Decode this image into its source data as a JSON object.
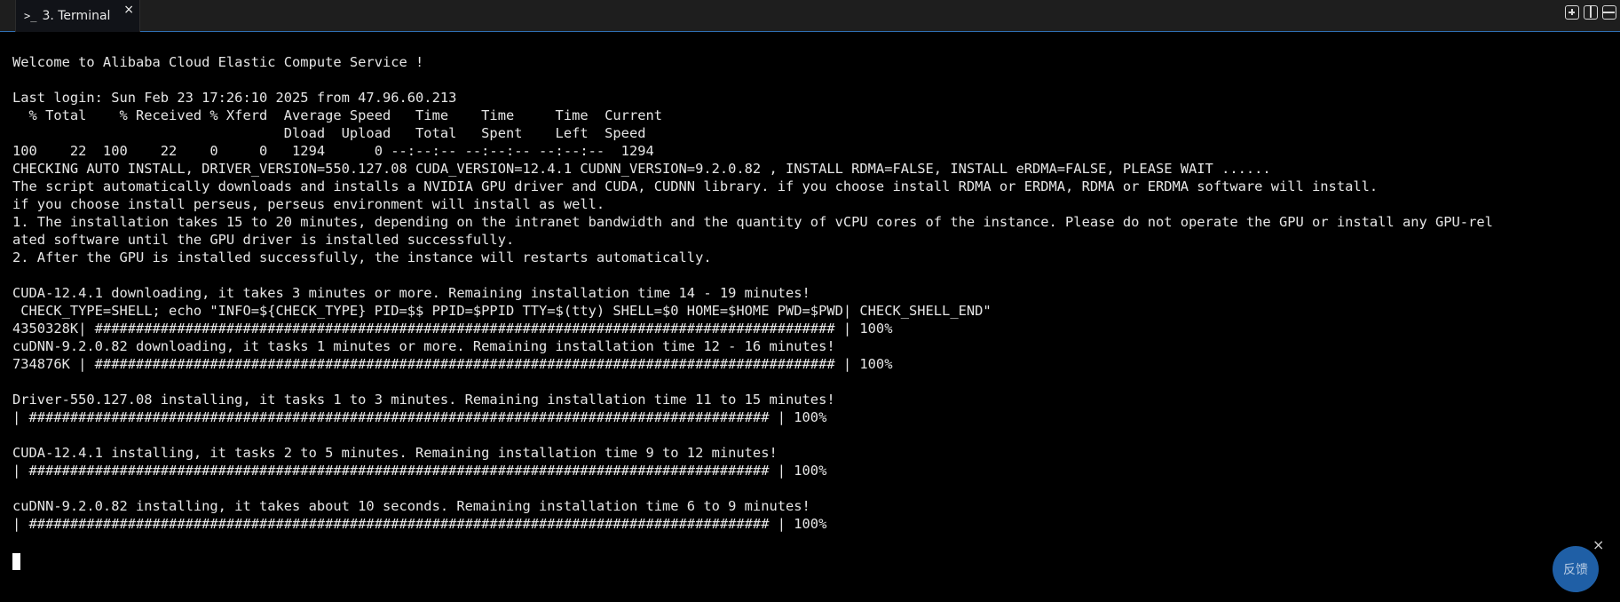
{
  "tab": {
    "icon": ">_",
    "title": "3. Terminal",
    "close_glyph": "×"
  },
  "terminal": {
    "lines": [
      "Welcome to Alibaba Cloud Elastic Compute Service !",
      "",
      "Last login: Sun Feb 23 17:26:10 2025 from 47.96.60.213",
      "  % Total    % Received % Xferd  Average Speed   Time    Time     Time  Current",
      "                                 Dload  Upload   Total   Spent    Left  Speed",
      "100    22  100    22    0     0   1294      0 --:--:-- --:--:-- --:--:--  1294",
      "CHECKING AUTO INSTALL, DRIVER_VERSION=550.127.08 CUDA_VERSION=12.4.1 CUDNN_VERSION=9.2.0.82 , INSTALL RDMA=FALSE, INSTALL eRDMA=FALSE, PLEASE WAIT ......",
      "The script automatically downloads and installs a NVIDIA GPU driver and CUDA, CUDNN library. if you choose install RDMA or ERDMA, RDMA or ERDMA software will install.",
      "if you choose install perseus, perseus environment will install as well.",
      "1. The installation takes 15 to 20 minutes, depending on the intranet bandwidth and the quantity of vCPU cores of the instance. Please do not operate the GPU or install any GPU-rel",
      "ated software until the GPU driver is installed successfully.",
      "2. After the GPU is installed successfully, the instance will restarts automatically.",
      "",
      "CUDA-12.4.1 downloading, it takes 3 minutes or more. Remaining installation time 14 - 19 minutes!",
      " CHECK_TYPE=SHELL; echo \"INFO=${CHECK_TYPE} PID=$$ PPID=$PPID TTY=$(tty) SHELL=$0 HOME=$HOME PWD=$PWD| CHECK_SHELL_END\"",
      "4350328K| ########################################################################################## | 100%",
      "cuDNN-9.2.0.82 downloading, it tasks 1 minutes or more. Remaining installation time 12 - 16 minutes!",
      "734876K | ########################################################################################## | 100%",
      "",
      "Driver-550.127.08 installing, it tasks 1 to 3 minutes. Remaining installation time 11 to 15 minutes!",
      "| ########################################################################################## | 100%",
      "",
      "CUDA-12.4.1 installing, it tasks 2 to 5 minutes. Remaining installation time 9 to 12 minutes!",
      "| ########################################################################################## | 100%",
      "",
      "cuDNN-9.2.0.82 installing, it takes about 10 seconds. Remaining installation time 6 to 9 minutes!",
      "| ########################################################################################## | 100%"
    ]
  },
  "feedback": {
    "label": "反馈",
    "close_glyph": "×"
  },
  "colors": {
    "terminal_bg": "#000000",
    "terminal_fg": "#e6e6e6",
    "tabbar_bg": "#1e1e1e",
    "accent": "#2f6fb3",
    "feedback_bg": "#1f5fa6"
  },
  "icons": {
    "tab": "terminal-prompt-icon",
    "new_tab": "add-square-icon",
    "split_vertical": "split-vertical-icon",
    "split_horizontal": "split-horizontal-icon"
  }
}
